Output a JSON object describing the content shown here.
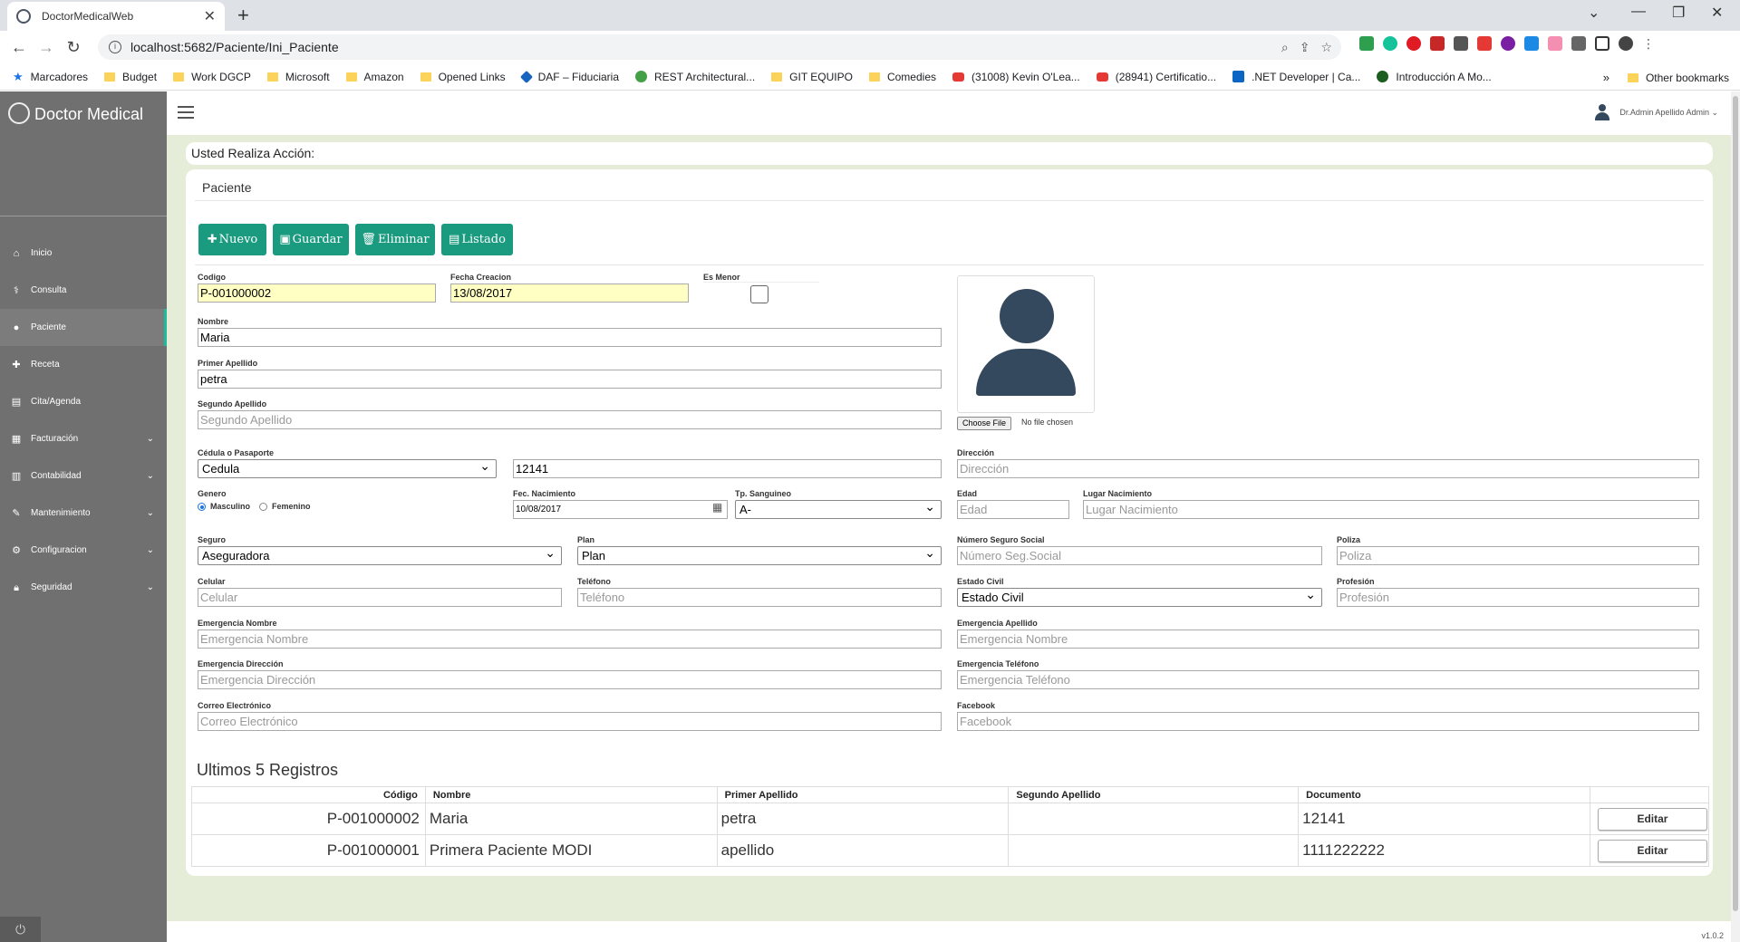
{
  "browser": {
    "tab_title": "DoctorMedicalWeb",
    "url": "localhost:5682/Paciente/Ini_Paciente",
    "bookmarks": [
      "Marcadores",
      "Budget",
      "Work DGCP",
      "Microsoft",
      "Amazon",
      "Opened Links",
      "DAF – Fiduciaria",
      "REST Architectural...",
      "GIT EQUIPO",
      "Comedies",
      "(31008) Kevin O'Lea...",
      "(28941) Certificatio...",
      ".NET Developer | Ca...",
      "Introducción A Mo..."
    ],
    "other_bookmarks": "Other bookmarks",
    "overflow": "»"
  },
  "app": {
    "brand": "Doctor Medical",
    "user": "Dr.Admin Apellido Admin ⌄",
    "version": "v1.0.2",
    "menu": [
      {
        "label": "Inicio",
        "icon": "home-icon"
      },
      {
        "label": "Consulta",
        "icon": "stethoscope-icon"
      },
      {
        "label": "Paciente",
        "icon": "user-icon",
        "active": true
      },
      {
        "label": "Receta",
        "icon": "medkit-icon"
      },
      {
        "label": "Cita/Agenda",
        "icon": "book-icon"
      },
      {
        "label": "Facturación",
        "icon": "invoice-icon",
        "chevron": true
      },
      {
        "label": "Contabilidad",
        "icon": "table-icon",
        "chevron": true
      },
      {
        "label": "Mantenimiento",
        "icon": "wrench-icon",
        "chevron": true
      },
      {
        "label": "Configuracion",
        "icon": "gear-icon",
        "chevron": true
      },
      {
        "label": "Seguridad",
        "icon": "lock-icon",
        "chevron": true
      }
    ]
  },
  "action_text": "Usted Realiza Acción:",
  "panel_title": "Paciente",
  "buttons": {
    "nuevo": "Nuevo",
    "guardar": "Guardar",
    "eliminar": "Eliminar",
    "listado": "Listado"
  },
  "form": {
    "codigo": {
      "label": "Codigo",
      "value": "P-001000002"
    },
    "fecha_creacion": {
      "label": "Fecha Creacion",
      "value": "13/08/2017"
    },
    "es_menor": {
      "label": "Es Menor"
    },
    "nombre": {
      "label": "Nombre",
      "value": "Maria"
    },
    "primer_apellido": {
      "label": "Primer Apellido",
      "value": "petra"
    },
    "segundo_apellido": {
      "label": "Segundo Apellido",
      "placeholder": "Segundo Apellido"
    },
    "cedula": {
      "label": "Cédula o Pasaporte",
      "type": "Cedula",
      "value": "12141"
    },
    "direccion": {
      "label": "Dirección",
      "placeholder": "Dirección"
    },
    "genero": {
      "label": "Genero",
      "masculino": "Masculino",
      "femenino": "Femenino"
    },
    "fec_nacimiento": {
      "label": "Fec. Nacimiento",
      "value": "10/08/2017"
    },
    "tp_sanguineo": {
      "label": "Tp. Sanguineo",
      "value": "A-"
    },
    "edad": {
      "label": "Edad",
      "placeholder": "Edad"
    },
    "lugar_nacimiento": {
      "label": "Lugar Nacimiento",
      "placeholder": "Lugar Nacimiento"
    },
    "seguro": {
      "label": "Seguro",
      "value": "Aseguradora"
    },
    "plan": {
      "label": "Plan",
      "value": "Plan"
    },
    "nss": {
      "label": "Número Seguro Social",
      "placeholder": "Número Seg.Social"
    },
    "poliza": {
      "label": "Poliza",
      "placeholder": "Poliza"
    },
    "celular": {
      "label": "Celular",
      "placeholder": "Celular"
    },
    "telefono": {
      "label": "Teléfono",
      "placeholder": "Teléfono"
    },
    "estado_civil": {
      "label": "Estado Civil",
      "value": "Estado Civil"
    },
    "profesion": {
      "label": "Profesión",
      "placeholder": "Profesión"
    },
    "emerg_nombre": {
      "label": "Emergencia Nombre",
      "placeholder": "Emergencia Nombre"
    },
    "emerg_apellido": {
      "label": "Emergencia Apellido",
      "placeholder": "Emergencia Nombre"
    },
    "emerg_direccion": {
      "label": "Emergencia Dirección",
      "placeholder": "Emergencia Dirección"
    },
    "emerg_telefono": {
      "label": "Emergencia Teléfono",
      "placeholder": "Emergencia Teléfono"
    },
    "correo": {
      "label": "Correo Electrónico",
      "placeholder": "Correo Electrónico"
    },
    "facebook": {
      "label": "Facebook",
      "placeholder": "Facebook"
    },
    "file_button": "Choose File",
    "file_status": "No file chosen"
  },
  "table": {
    "title": "Ultimos 5 Registros",
    "headers": [
      "Código",
      "Nombre",
      "Primer Apellido",
      "Segundo Apellido",
      "Documento",
      ""
    ],
    "rows": [
      {
        "codigo": "P-001000002",
        "nombre": "Maria",
        "primer": "petra",
        "segundo": "",
        "documento": "12141",
        "action": "Editar"
      },
      {
        "codigo": "P-001000001",
        "nombre": "Primera Paciente MODI",
        "primer": "apellido",
        "segundo": "",
        "documento": "1111222222",
        "action": "Editar"
      }
    ]
  }
}
